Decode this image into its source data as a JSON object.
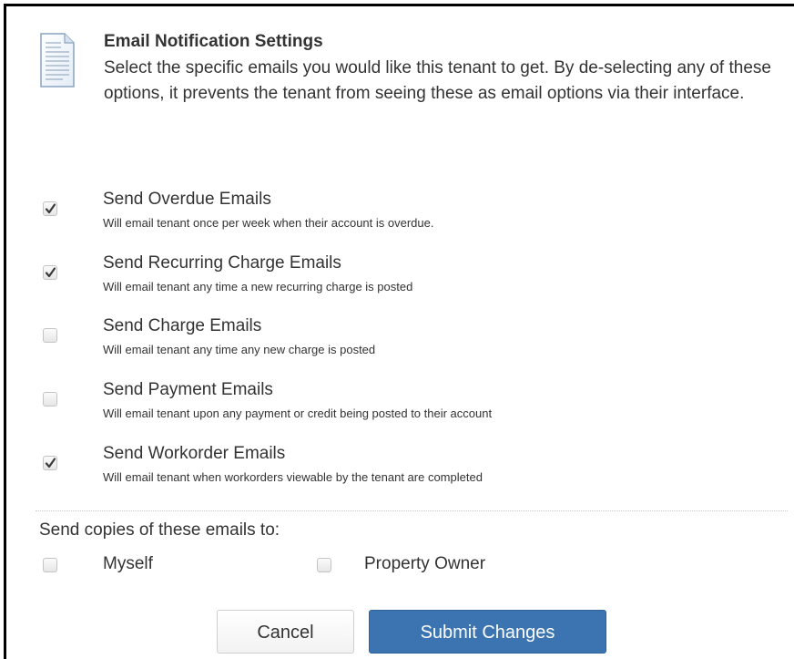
{
  "header": {
    "icon": "document-icon",
    "title": "Email Notification Settings",
    "description": "Select the specific emails you would like this tenant to get. By de-selecting any of these options, it prevents the tenant from seeing these as email options via their interface."
  },
  "options": [
    {
      "label": "Send Overdue Emails",
      "help": "Will email tenant once per week when their account is overdue.",
      "checked": true
    },
    {
      "label": "Send Recurring Charge Emails",
      "help": "Will email tenant any time a new recurring charge is posted",
      "checked": true
    },
    {
      "label": "Send Charge Emails",
      "help": "Will email tenant any time any new charge is posted",
      "checked": false
    },
    {
      "label": "Send Payment Emails",
      "help": "Will email tenant upon any payment or credit being posted to their account",
      "checked": false
    },
    {
      "label": "Send Workorder Emails",
      "help": "Will email tenant when workorders viewable by the tenant are completed",
      "checked": true
    }
  ],
  "copies": {
    "label": "Send copies of these emails to:",
    "myself": {
      "label": "Myself",
      "checked": false
    },
    "owner": {
      "label": "Property Owner",
      "checked": false
    }
  },
  "buttons": {
    "cancel": "Cancel",
    "submit": "Submit Changes"
  },
  "colors": {
    "primary": "#3b74b0",
    "text": "#333333",
    "check": "#3a3a3a"
  }
}
